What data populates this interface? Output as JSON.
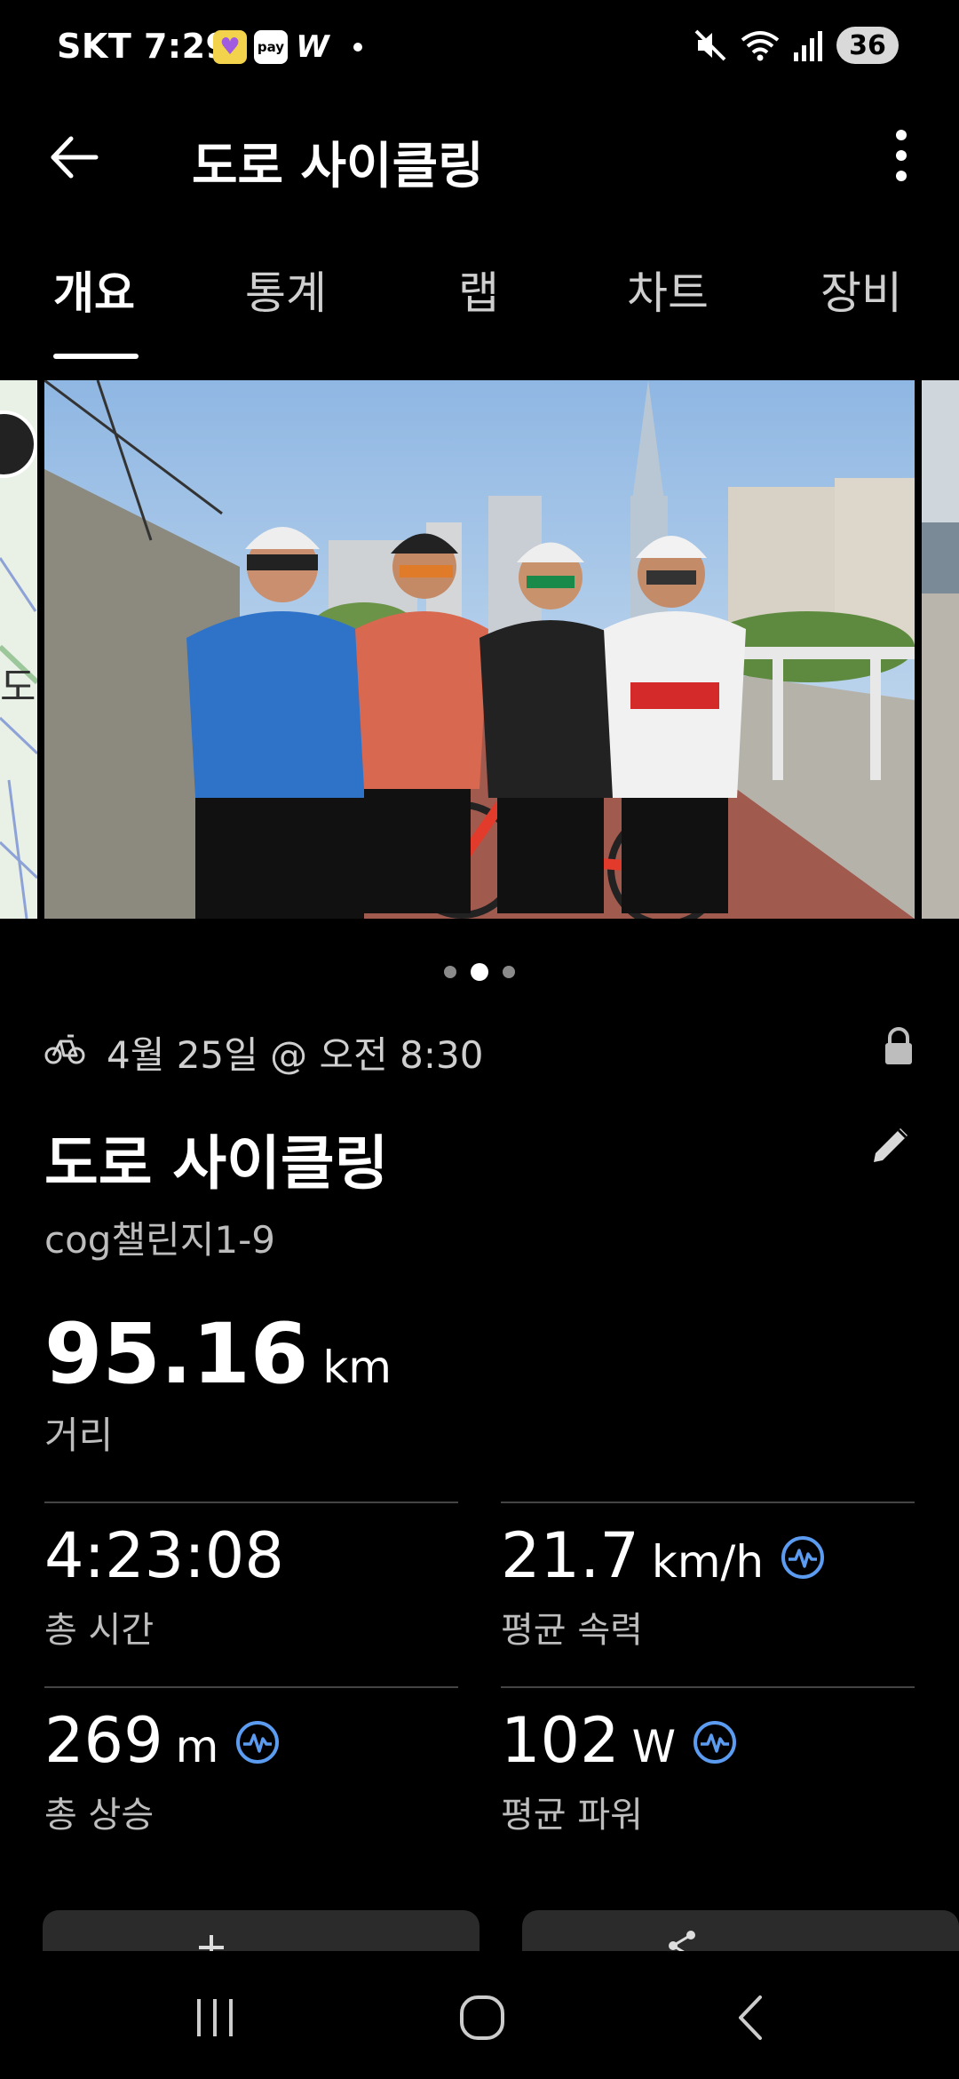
{
  "status_bar": {
    "carrier_time": "SKT 7:29",
    "pay_label": "pay",
    "w_label": "W",
    "battery": "36"
  },
  "app_bar": {
    "title": "도로 사이클링"
  },
  "tabs": [
    {
      "label": "개요",
      "active": true
    },
    {
      "label": "통계"
    },
    {
      "label": "랩"
    },
    {
      "label": "차트"
    },
    {
      "label": "장비"
    }
  ],
  "carousel": {
    "slide_count": 3,
    "active_index": 1
  },
  "activity": {
    "date": "4월 25일 @ 오전 8:30",
    "name": "도로 사이클링",
    "description": "cog챌린지1-9",
    "distance_value": "95.16",
    "distance_unit": "km",
    "distance_label": "거리"
  },
  "stats": [
    {
      "value": "4:23:08",
      "unit": "",
      "label": "총 시간",
      "icon": false
    },
    {
      "value": "21.7",
      "unit": "km/h",
      "label": "평균 속력",
      "icon": true
    },
    {
      "value": "269",
      "unit": "m",
      "label": "총 상승",
      "icon": true
    },
    {
      "value": "102",
      "unit": "W",
      "label": "평균 파워",
      "icon": true
    }
  ],
  "colors": {
    "accent": "#5b9bf0",
    "background": "#000000",
    "secondary_text": "#bdbdbd"
  }
}
